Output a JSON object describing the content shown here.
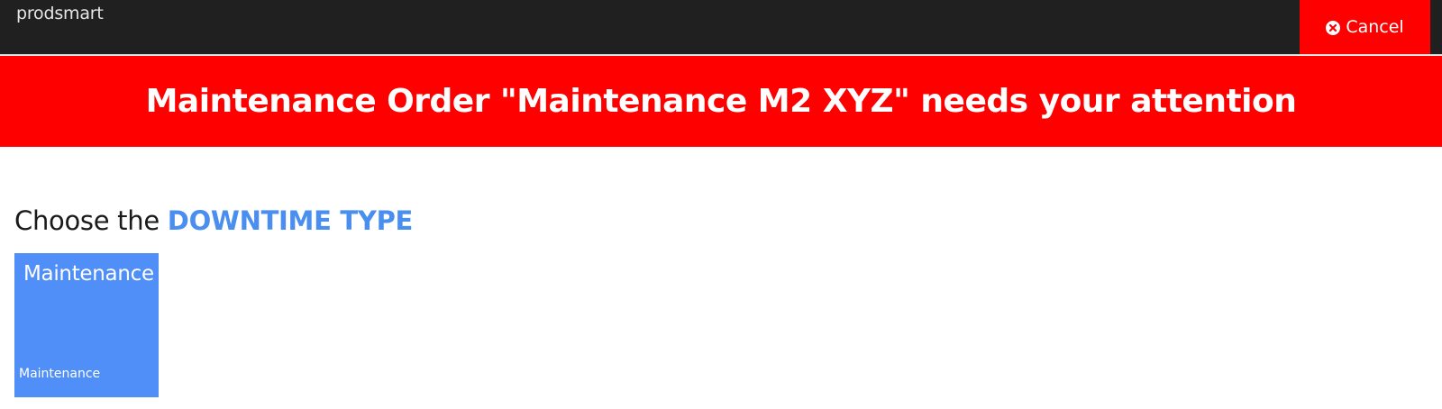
{
  "header": {
    "logo": "prodsmart",
    "cancel_label": "Cancel",
    "cancel_icon": "close-circle-icon"
  },
  "alert": {
    "title": "Maintenance Order \"Maintenance M2 XYZ\" needs your attention"
  },
  "prompt": {
    "prefix": "Choose the ",
    "highlight": "DOWNTIME TYPE"
  },
  "downtime_types": [
    {
      "title": "Maintenance",
      "subtitle": "Maintenance"
    }
  ],
  "colors": {
    "topbar": "#202020",
    "alert_red": "#fe0000",
    "accent_blue": "#4a8ef0",
    "tile_blue": "#4f8ff7"
  }
}
